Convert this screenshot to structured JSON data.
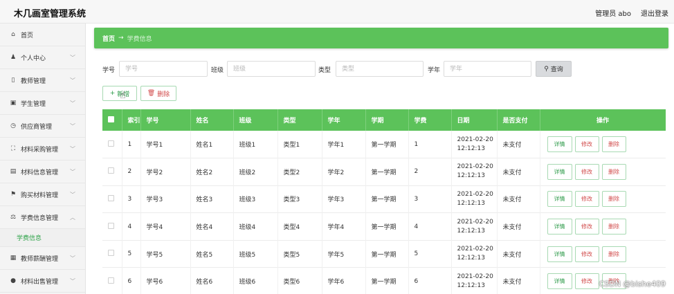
{
  "header": {
    "title": "木几画室管理系统",
    "user": "管理员 abo",
    "logout": "退出登录"
  },
  "sidebar": {
    "items": [
      {
        "icon": "home-icon",
        "glyph": "⌂",
        "label": "首页",
        "chevron": ""
      },
      {
        "icon": "user-icon",
        "glyph": "♟",
        "label": "个人中心",
        "chevron": "﹀"
      },
      {
        "icon": "teacher-icon",
        "glyph": "▯",
        "label": "教师管理",
        "chevron": "﹀"
      },
      {
        "icon": "student-icon",
        "glyph": "▣",
        "label": "学生管理",
        "chevron": "﹀"
      },
      {
        "icon": "supplier-icon",
        "glyph": "◷",
        "label": "供应商管理",
        "chevron": "﹀"
      },
      {
        "icon": "purchase-icon",
        "glyph": "⛶",
        "label": "材料采购管理",
        "chevron": "﹀"
      },
      {
        "icon": "material-info-icon",
        "glyph": "▤",
        "label": "材料信息管理",
        "chevron": "﹀"
      },
      {
        "icon": "buy-material-icon",
        "glyph": "⚑",
        "label": "购买材料管理",
        "chevron": "﹀"
      },
      {
        "icon": "fee-icon",
        "glyph": "⚖",
        "label": "学费信息管理",
        "chevron": "︿",
        "sub": "学费信息"
      },
      {
        "icon": "salary-icon",
        "glyph": "▦",
        "label": "教师薪酬管理",
        "chevron": "﹀"
      },
      {
        "icon": "sale-icon",
        "glyph": "●",
        "label": "材料出售管理",
        "chevron": "﹀"
      }
    ]
  },
  "breadcrumb": {
    "home": "首页",
    "arrow": "→",
    "current": "学费信息"
  },
  "search": {
    "fields": [
      {
        "label": "学号",
        "placeholder": "学号"
      },
      {
        "label": "班级",
        "placeholder": "班级"
      },
      {
        "label": "类型",
        "placeholder": "类型"
      },
      {
        "label": "学年",
        "placeholder": "学年"
      }
    ],
    "query_icon": "search-icon",
    "query_label": "查询"
  },
  "actions": {
    "add_label": "新增",
    "add_glyph": "+",
    "delete_label": "删除",
    "delete_glyph": "🗑"
  },
  "table": {
    "columns": [
      "索引",
      "学号",
      "姓名",
      "班级",
      "类型",
      "学年",
      "学期",
      "学费",
      "日期",
      "是否支付",
      "操作"
    ],
    "rows": [
      {
        "idx": "1",
        "no": "学号1",
        "name": "姓名1",
        "cls": "班级1",
        "type": "类型1",
        "year": "学年1",
        "term": "第一学期",
        "fee": "1",
        "date1": "2021-02-20",
        "date2": "12:12:13",
        "paid": "未支付"
      },
      {
        "idx": "2",
        "no": "学号2",
        "name": "姓名2",
        "cls": "班级2",
        "type": "类型2",
        "year": "学年2",
        "term": "第一学期",
        "fee": "2",
        "date1": "2021-02-20",
        "date2": "12:12:13",
        "paid": "未支付"
      },
      {
        "idx": "3",
        "no": "学号3",
        "name": "姓名3",
        "cls": "班级3",
        "type": "类型3",
        "year": "学年3",
        "term": "第一学期",
        "fee": "3",
        "date1": "2021-02-20",
        "date2": "12:12:13",
        "paid": "未支付"
      },
      {
        "idx": "4",
        "no": "学号4",
        "name": "姓名4",
        "cls": "班级4",
        "type": "类型4",
        "year": "学年4",
        "term": "第一学期",
        "fee": "4",
        "date1": "2021-02-20",
        "date2": "12:12:13",
        "paid": "未支付"
      },
      {
        "idx": "5",
        "no": "学号5",
        "name": "姓名5",
        "cls": "班级5",
        "type": "类型5",
        "year": "学年5",
        "term": "第一学期",
        "fee": "5",
        "date1": "2021-02-20",
        "date2": "12:12:13",
        "paid": "未支付"
      },
      {
        "idx": "6",
        "no": "学号6",
        "name": "姓名6",
        "cls": "班级6",
        "type": "类型6",
        "year": "学年6",
        "term": "第一学期",
        "fee": "6",
        "date1": "2021-02-20",
        "date2": "12:12:13",
        "paid": "未支付"
      }
    ],
    "ops": {
      "detail": "详情",
      "edit": "修改",
      "remove": "删除"
    }
  },
  "watermark": "CSDN @bishe409",
  "colors": {
    "primary_green": "#5cc25a",
    "active_text": "#2fa34a",
    "danger": "#d14b4b"
  }
}
